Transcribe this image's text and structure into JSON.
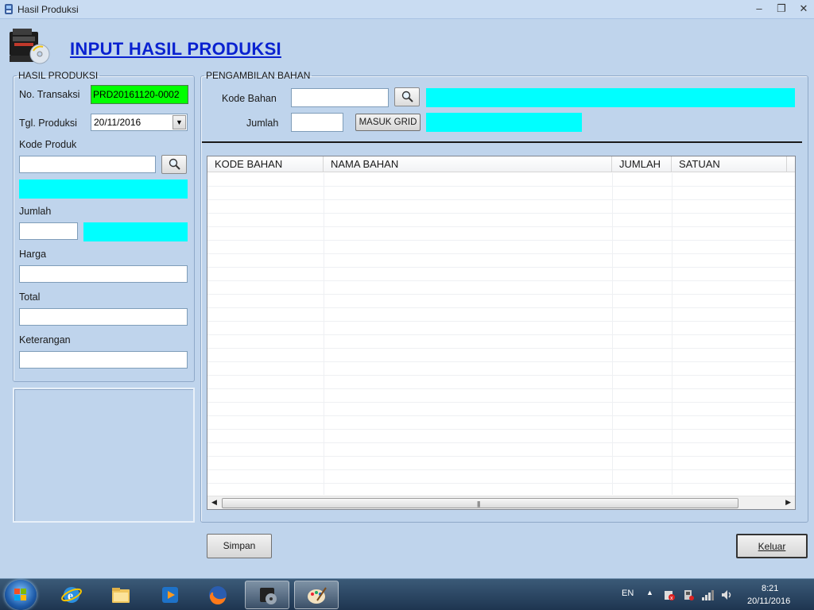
{
  "window": {
    "title": "Hasil Produksi",
    "controls": [
      "–",
      "❐",
      "✕"
    ]
  },
  "page_title": "INPUT HASIL PRODUKSI",
  "hasil_produksi": {
    "legend": "HASIL PRODUKSI",
    "no_transaksi_label": "No. Transaksi",
    "no_transaksi_value": "PRD20161120-0002",
    "tgl_produksi_label": "Tgl. Produksi",
    "tgl_produksi_value": "20/11/2016",
    "kode_produk_label": "Kode Produk",
    "jumlah_label": "Jumlah",
    "harga_label": "Harga",
    "total_label": "Total",
    "keterangan_label": "Keterangan"
  },
  "pengambilan_bahan": {
    "legend": "PENGAMBILAN BAHAN",
    "kode_bahan_label": "Kode Bahan",
    "jumlah_label": "Jumlah",
    "masuk_grid_label": "MASUK GRID"
  },
  "grid": {
    "columns": [
      "KODE BAHAN",
      "NAMA BAHAN",
      "JUMLAH",
      "SATUAN"
    ]
  },
  "buttons": {
    "simpan": "Simpan",
    "keluar": "Keluar"
  },
  "taskbar": {
    "language": "EN",
    "time": "8:21",
    "date": "20/11/2016",
    "icons": [
      "ie-icon",
      "explorer-icon",
      "media-player-icon",
      "firefox-icon",
      "app-icon",
      "paint-icon"
    ]
  },
  "colors": {
    "highlight_cyan": "#00ffff",
    "transaction_green": "#00ff00",
    "title_blue": "#0a22d0"
  }
}
